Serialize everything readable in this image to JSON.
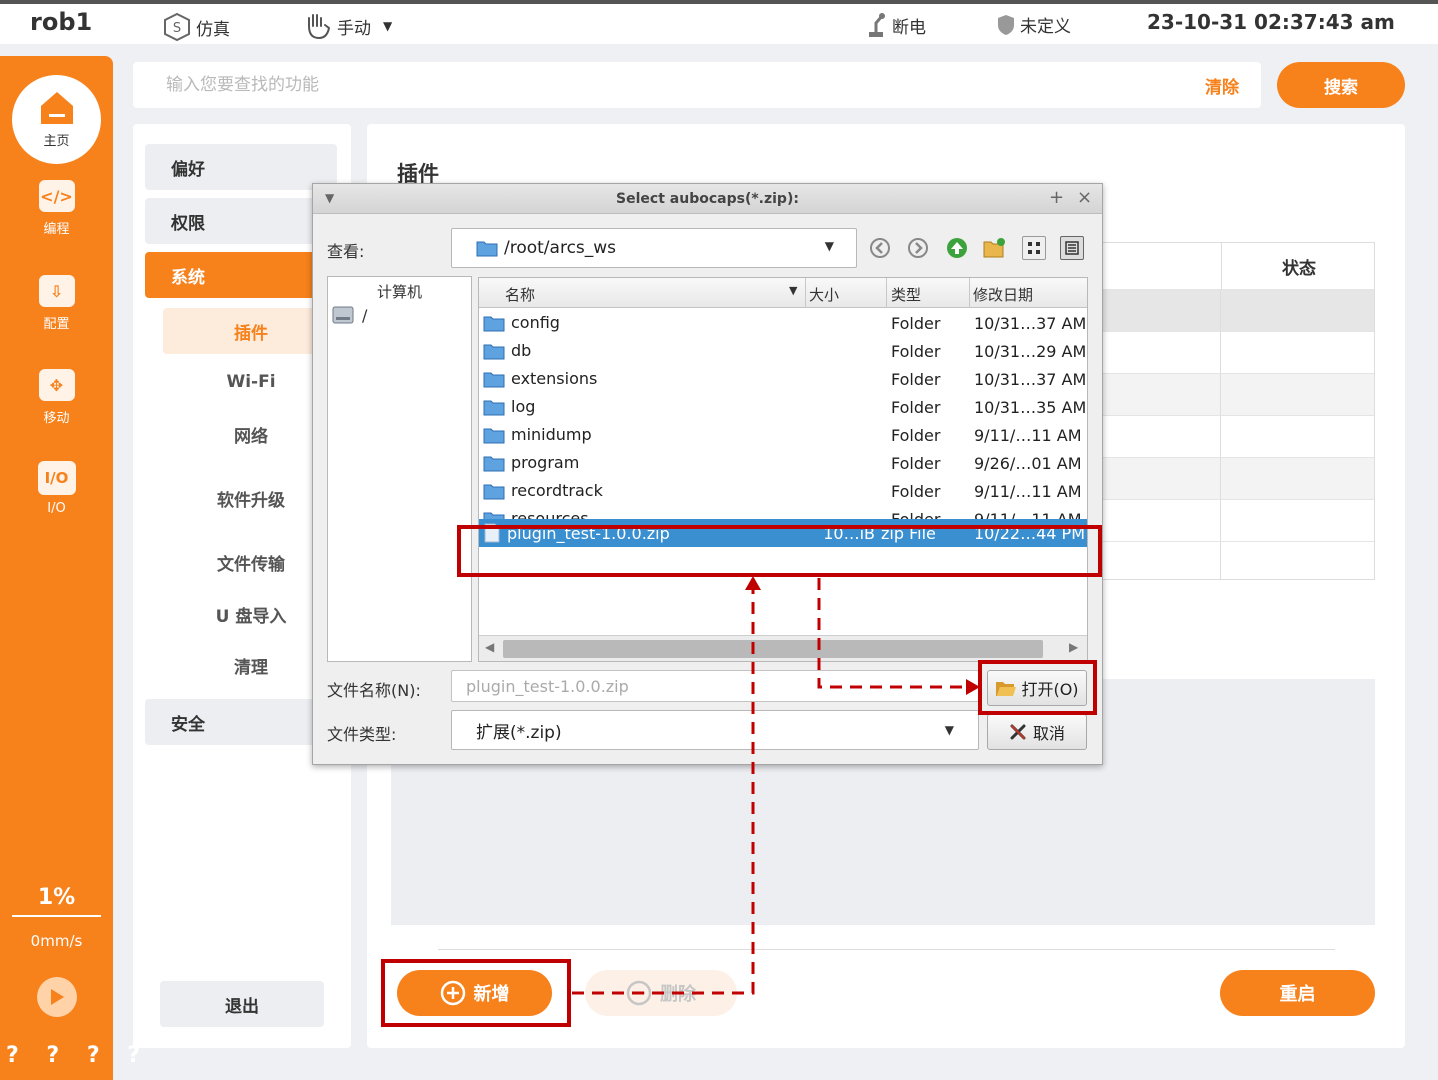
{
  "topbar": {
    "robot_name": "rob1",
    "sim_label": "仿真",
    "mode_label": "手动",
    "power_label": "断电",
    "safety_label": "未定义",
    "datetime": "23-10-31 02:37:43 am"
  },
  "rail": {
    "home": "主页",
    "items": [
      {
        "icon": "</>",
        "label": "编程"
      },
      {
        "icon": "⇩",
        "label": "配置"
      },
      {
        "icon": "✥",
        "label": "移动"
      },
      {
        "icon": "I/O",
        "label": "I/O"
      }
    ],
    "speed_percent": "1%",
    "speed_mms": "0mm/s",
    "help": "? ? ? ?"
  },
  "search": {
    "placeholder": "输入您要查找的功能",
    "clear_label": "清除",
    "search_label": "搜索"
  },
  "menu": {
    "cat_preference": "偏好",
    "cat_permission": "权限",
    "cat_system": "系统",
    "sub_plugin": "插件",
    "sub_wifi": "Wi-Fi",
    "sub_network": "网络",
    "sub_upgrade": "软件升级",
    "sub_transfer": "文件传输",
    "sub_usb": "U 盘导入",
    "sub_clean": "清理",
    "cat_security": "安全",
    "logout": "退出"
  },
  "content": {
    "title": "插件",
    "status_header": "状态",
    "add_label": "新增",
    "delete_label": "删除",
    "restart_label": "重启"
  },
  "dialog": {
    "title": "Select aubocaps(*.zip):",
    "look_in_label": "查看:",
    "path": "/root/arcs_ws",
    "sidebar_header": "计算机",
    "sidebar_root": "/",
    "columns": {
      "name": "名称",
      "size": "大小",
      "type": "类型",
      "date": "修改日期"
    },
    "files": [
      {
        "name": "config",
        "size": "",
        "type": "Folder",
        "date": "10/31…37 AM"
      },
      {
        "name": "db",
        "size": "",
        "type": "Folder",
        "date": "10/31…29 AM"
      },
      {
        "name": "extensions",
        "size": "",
        "type": "Folder",
        "date": "10/31…37 AM"
      },
      {
        "name": "log",
        "size": "",
        "type": "Folder",
        "date": "10/31…35 AM"
      },
      {
        "name": "minidump",
        "size": "",
        "type": "Folder",
        "date": "9/11/…11 AM"
      },
      {
        "name": "program",
        "size": "",
        "type": "Folder",
        "date": "9/26/…01 AM"
      },
      {
        "name": "recordtrack",
        "size": "",
        "type": "Folder",
        "date": "9/11/…11 AM"
      },
      {
        "name": "resources",
        "size": "",
        "type": "Folder",
        "date": "9/11/…11 AM"
      },
      {
        "name": "plugin_test-1.0.0.zip",
        "size": "10…iB",
        "type": "zip File",
        "date": "10/22…44 PM"
      }
    ],
    "filename_label": "文件名称(N):",
    "filename_value": "plugin_test-1.0.0.zip",
    "filetype_label": "文件类型:",
    "filetype_value": "扩展(*.zip)",
    "open_label": "打开(O)",
    "cancel_label": "取消"
  },
  "colors": {
    "brand_orange": "#f7811b",
    "highlight_red": "#c00000",
    "selection_blue": "#3a8fd1"
  }
}
